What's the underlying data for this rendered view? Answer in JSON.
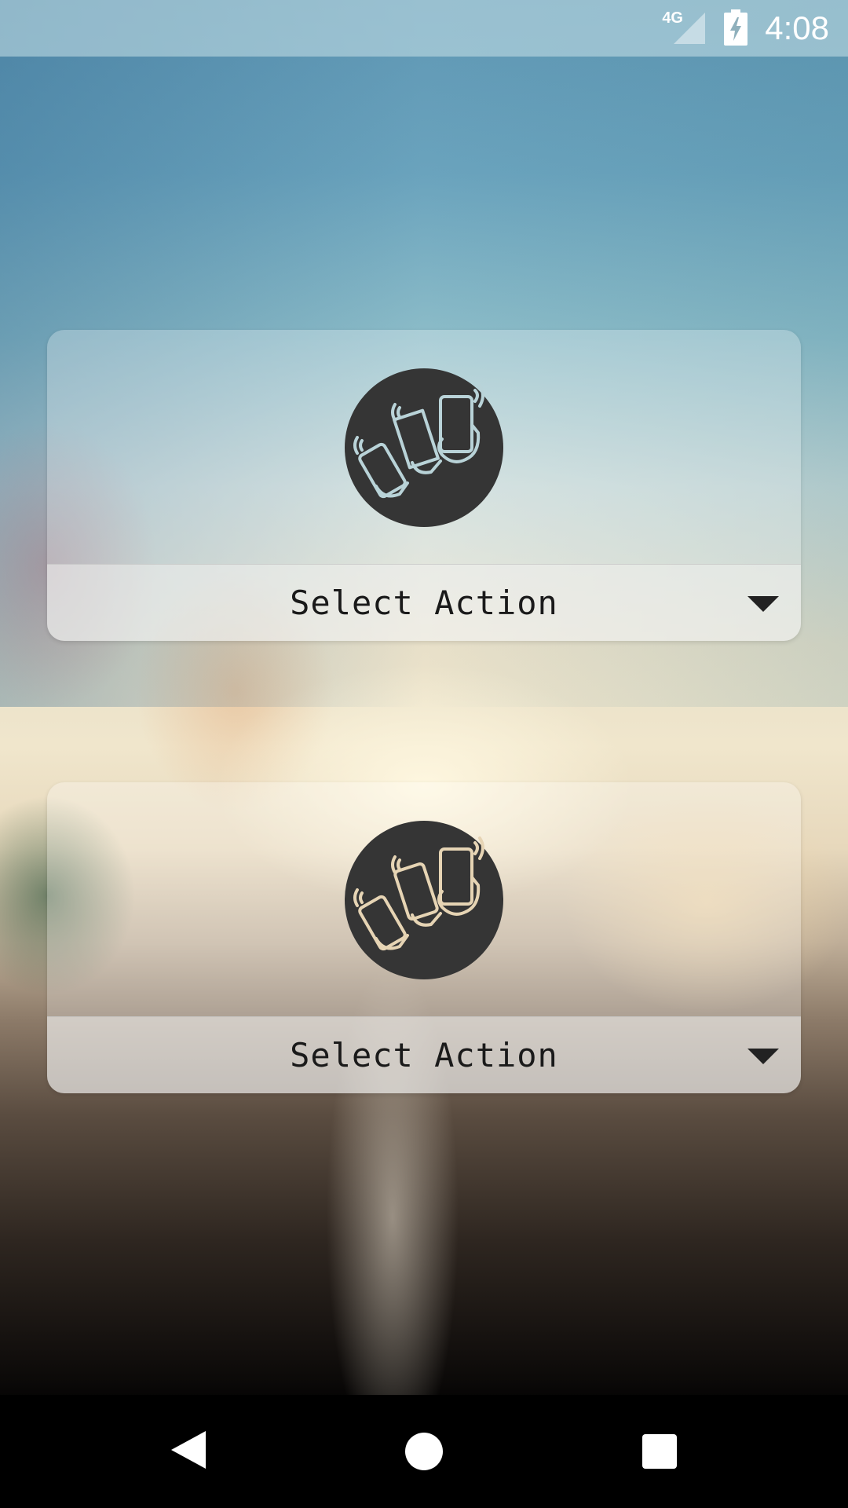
{
  "status_bar": {
    "network_type": "4G",
    "time": "4:08",
    "icons": [
      "signal-icon",
      "battery-charging-icon"
    ]
  },
  "cards": [
    {
      "icon": "phones-shake-icon",
      "icon_color": "#b9d3d8",
      "select_label": "Select Action"
    },
    {
      "icon": "phones-shake-icon",
      "icon_color": "#e6d4b4",
      "select_label": "Select Action"
    }
  ],
  "nav_bar": {
    "icons": [
      "back-icon",
      "home-icon",
      "recents-icon"
    ]
  },
  "colors": {
    "icon_circle": "#353535",
    "nav_bar": "#000000",
    "label_text": "#1a1a1a"
  }
}
